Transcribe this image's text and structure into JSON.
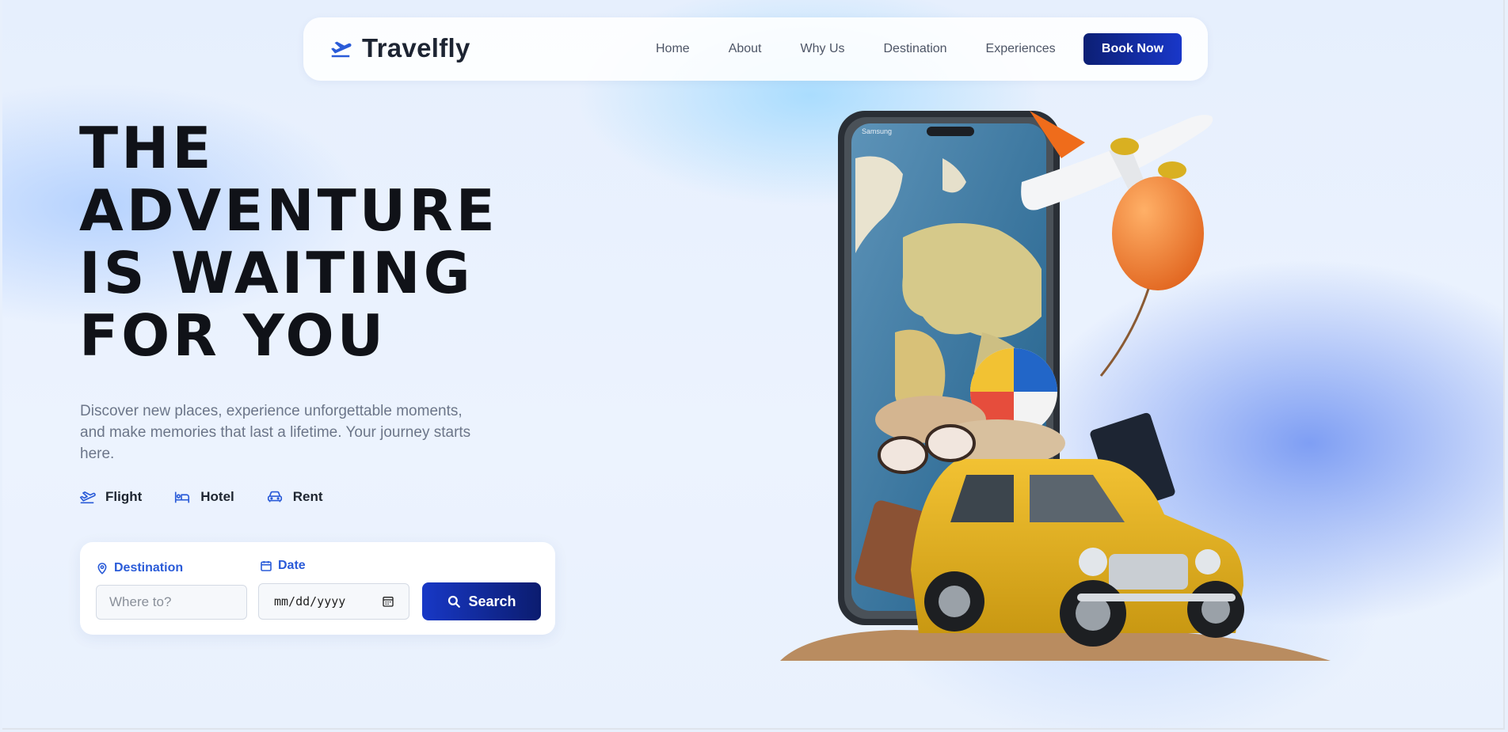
{
  "brand": {
    "name": "Travelfly",
    "icon": "plane-departure-icon"
  },
  "nav": {
    "links": [
      "Home",
      "About",
      "Why Us",
      "Destination",
      "Experiences"
    ],
    "cta": "Book Now"
  },
  "hero": {
    "headline": [
      "THE",
      "ADVENTURE",
      "IS WAITING",
      "FOR YOU"
    ],
    "subtitle": "Discover new places, experience unforgettable moments, and make memories that last a lifetime. Your journey starts here.",
    "services": [
      {
        "label": "Flight",
        "icon": "plane-icon"
      },
      {
        "label": "Hotel",
        "icon": "bed-icon"
      },
      {
        "label": "Rent",
        "icon": "car-icon"
      }
    ]
  },
  "search": {
    "destination_label": "Destination",
    "destination_placeholder": "Where to?",
    "date_label": "Date",
    "date_placeholder": "mm/dd/yyyy",
    "button_label": "Search"
  },
  "illustration": {
    "phone_status": "Samsung"
  },
  "colors": {
    "accent": "#2a5bd8",
    "dark_blue": "#0b1c6f",
    "text_dark": "#101218"
  }
}
